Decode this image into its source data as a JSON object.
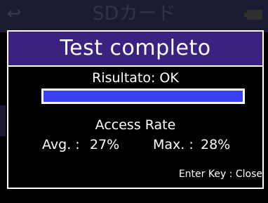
{
  "background": {
    "title": "SDカード",
    "back_icon": "back-arrow-icon",
    "battery_icon": "battery-icon"
  },
  "dialog": {
    "title": "Test completo",
    "result": "Risultato: OK",
    "progress": {
      "value": 1.0
    },
    "rate_label": "Access Rate",
    "avg_label": "Avg. :",
    "avg_value": "27%",
    "max_label": "Max. :",
    "max_value": "28%",
    "footer_hint": "Enter Key : Close"
  },
  "colors": {
    "header": "#3b2280",
    "progress_fill": "#3a3ff0",
    "text": "#ffffff",
    "background": "#000000"
  }
}
